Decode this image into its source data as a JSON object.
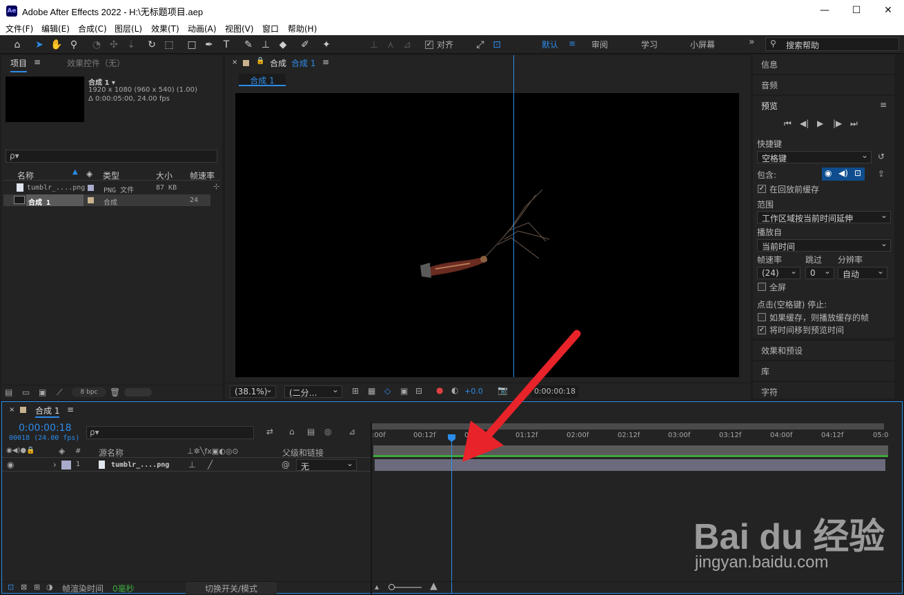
{
  "app": {
    "title": "Adobe After Effects 2022 - H:\\无标题项目.aep",
    "logo": "Ae"
  },
  "window_controls": {
    "minimize": "—",
    "maximize": "☐",
    "close": "✕"
  },
  "menu": [
    "文件(F)",
    "编辑(E)",
    "合成(C)",
    "图层(L)",
    "效果(T)",
    "动画(A)",
    "视图(V)",
    "窗口",
    "帮助(H)"
  ],
  "toolbar": {
    "align_label": "对齐",
    "workspaces": [
      "默认",
      "审阅",
      "学习",
      "小屏幕"
    ],
    "search_placeholder": "搜索帮助",
    "more": "»"
  },
  "project": {
    "tab": "项目",
    "effects_tab": "效果控件（无）",
    "comp_name": "合成 1 ▾",
    "comp_info1": "1920 x 1080  (960 x 540) (1.00)",
    "comp_info2": "Δ 0:00:05:00, 24.00 fps",
    "search_icon": "ρ▾",
    "headers": [
      "名称",
      "类型",
      "大小",
      "帧速率"
    ],
    "items": [
      {
        "name": "tumblr_....png",
        "type": "PNG 文件",
        "size": "87 KB",
        "fps": ""
      },
      {
        "name": "合成 1",
        "type": "合成",
        "size": "",
        "fps": "24"
      }
    ],
    "bpc": "8 bpc"
  },
  "comp_viewer": {
    "tab": "合成",
    "tab_name": "合成 1",
    "sub_tab": "合成 1",
    "zoom": "(38.1%)",
    "resolution": "(二分…",
    "exposure": "+0.0",
    "timecode": "0:00:00:18"
  },
  "right_panels": {
    "info": "信息",
    "audio": "音频",
    "preview": "预览",
    "shortcut_label": "快捷键",
    "shortcut_value": "空格键",
    "include_label": "包含:",
    "cache_before": "在回放前缓存",
    "range_label": "范围",
    "range_value": "工作区域按当前时间延伸",
    "play_from_label": "播放自",
    "play_from_value": "当前时间",
    "fps_label": "帧速率",
    "skip_label": "跳过",
    "res_label": "分辨率",
    "fps_value": "(24)",
    "skip_value": "0",
    "res_value": "自动",
    "fullscreen": "全屏",
    "stop_label": "点击(空格键) 停止:",
    "if_cached": "如果缓存，则播放缓存的帧",
    "move_time": "将时间移到预览时间",
    "effects_presets": "效果和预设",
    "library": "库",
    "character": "字符"
  },
  "timeline": {
    "tab": "合成 1",
    "timecode": "0:00:00:18",
    "frame_info": "00018 (24.00 fps)",
    "col_source": "源名称",
    "col_parent": "父级和链接",
    "layer_num": "1",
    "layer_name": "tumblr_....png",
    "parent_value": "无",
    "ruler": [
      ":00f",
      "00:12f",
      "01:00f",
      "01:12f",
      "02:00f",
      "02:12f",
      "03:00f",
      "03:12f",
      "04:00f",
      "04:12f",
      "05:0"
    ],
    "render_time_label": "帧渲染时间",
    "render_time_value": "0毫秒",
    "toggle_mode": "切换开关/模式"
  },
  "watermark": {
    "brand": "Bai du 经验",
    "url": "jingyan.baidu.com"
  },
  "colors": {
    "accent": "#2d8ceb",
    "arrow": "#e8232a",
    "layer_bar": "#6b6b7d",
    "work_area": "#3ea83e"
  }
}
